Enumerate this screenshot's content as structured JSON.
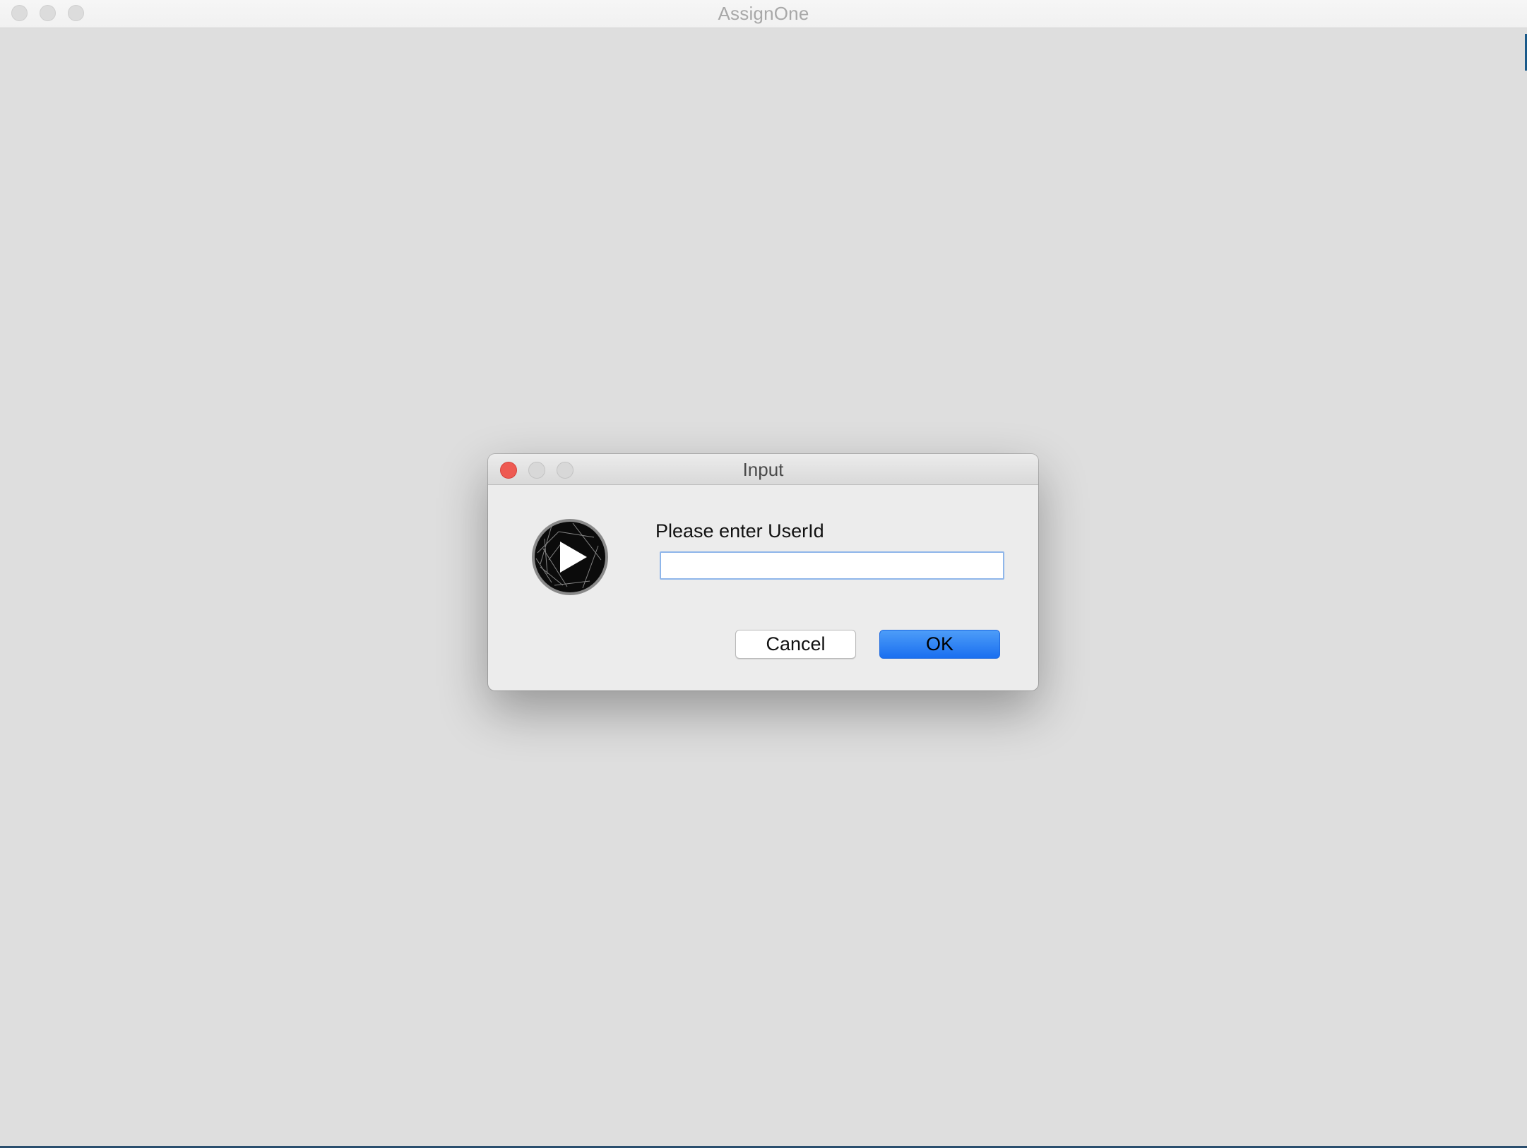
{
  "main_window": {
    "title": "AssignOne"
  },
  "dialog": {
    "title": "Input",
    "icon": "play-icon",
    "prompt": "Please enter UserId",
    "input": {
      "value": "",
      "placeholder": ""
    },
    "buttons": {
      "cancel_label": "Cancel",
      "ok_label": "OK"
    }
  },
  "colors": {
    "close": "#ee5a52",
    "ok_button": "#1a6ff0",
    "input_focus": "#8fb6ea",
    "window_bg": "#dedede"
  }
}
